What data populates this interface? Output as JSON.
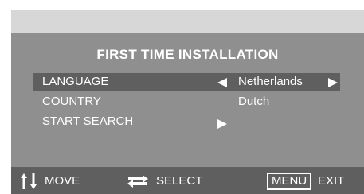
{
  "title": "FIRST TIME INSTALLATION",
  "menu": {
    "rows": [
      {
        "label": "LANGUAGE",
        "value": "Netherlands",
        "selected": true
      },
      {
        "label": "COUNTRY",
        "value": "Dutch",
        "selected": false
      },
      {
        "label": "START SEARCH",
        "value": "",
        "selected": false
      }
    ]
  },
  "footer": {
    "move_label": "MOVE",
    "select_label": "SELECT",
    "menu_key_label": "MENU",
    "exit_label": "EXIT"
  },
  "icons": {
    "left": "left-triangle-icon",
    "right": "right-triangle-icon",
    "move": "up-down-arrows-icon",
    "select": "swap-arrows-icon"
  },
  "colors": {
    "panel": "#8f8f8f",
    "highlight": "#5f5f5f",
    "top_bar": "#d7d7d7",
    "text": "#ffffff"
  }
}
